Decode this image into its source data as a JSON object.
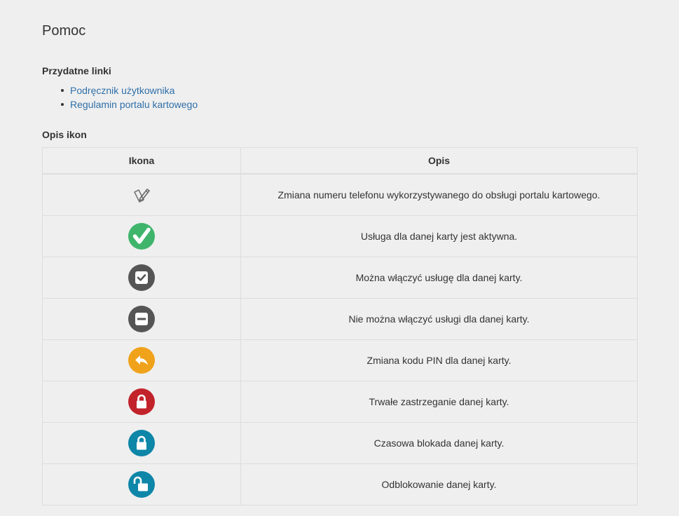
{
  "page": {
    "title": "Pomoc"
  },
  "useful_links": {
    "heading": "Przydatne linki",
    "items": [
      {
        "label": "Podręcznik użytkownika"
      },
      {
        "label": "Regulamin portalu kartowego"
      }
    ]
  },
  "icons_section": {
    "heading": "Opis ikon",
    "columns": [
      "Ikona",
      "Opis"
    ],
    "rows": [
      {
        "icon": "edit-phone-icon",
        "description": "Zmiana numeru telefonu wykorzystywanego do obsługi portalu kartowego."
      },
      {
        "icon": "active-check-icon",
        "color": "#3fb56b",
        "description": "Usługa dla danej karty jest aktywna."
      },
      {
        "icon": "enable-checkbox-icon",
        "color": "#555555",
        "description": "Można włączyć usługę dla danej karty."
      },
      {
        "icon": "disabled-minus-icon",
        "color": "#555555",
        "description": "Nie można włączyć usługi dla danej karty."
      },
      {
        "icon": "change-pin-icon",
        "color": "#f0a21a",
        "description": "Zmiana kodu PIN dla danej karty."
      },
      {
        "icon": "permanent-block-lock-icon",
        "color": "#c2232b",
        "description": "Trwałe zastrzeganie danej karty."
      },
      {
        "icon": "temporary-lock-icon",
        "color": "#0d86a8",
        "description": "Czasowa blokada danej karty."
      },
      {
        "icon": "unlock-icon",
        "color": "#0d86a8",
        "description": "Odblokowanie danej karty."
      }
    ]
  },
  "colors": {
    "link": "#2f6fa8",
    "background": "#efefef",
    "border": "#dddddd"
  }
}
